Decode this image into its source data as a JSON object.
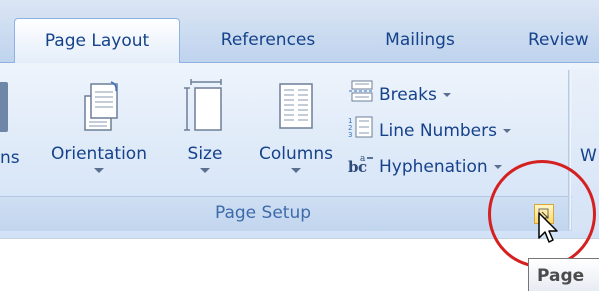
{
  "tabs": [
    {
      "label": "Page Layout",
      "active": true
    },
    {
      "label": "References",
      "active": false
    },
    {
      "label": "Mailings",
      "active": false
    },
    {
      "label": "Review",
      "active": false
    }
  ],
  "page_setup": {
    "group_label": "Page Setup",
    "buttons": {
      "margins_partial": "ns",
      "orientation": "Orientation",
      "size": "Size",
      "columns": "Columns"
    },
    "small_buttons": {
      "breaks": "Breaks",
      "line_numbers": "Line Numbers",
      "hyphenation": "Hyphenation"
    }
  },
  "next_group_partial": "W",
  "tooltip": {
    "text": "Page"
  },
  "colors": {
    "ribbon_text": "#15428b",
    "group_label": "#3e6aaa",
    "highlight_circle": "#d42020",
    "launcher": "#ffd86a"
  },
  "icons": [
    "orientation-icon",
    "size-icon",
    "columns-icon",
    "breaks-icon",
    "line-numbers-icon",
    "hyphenation-icon",
    "dialog-launcher-icon",
    "mouse-cursor-icon"
  ]
}
